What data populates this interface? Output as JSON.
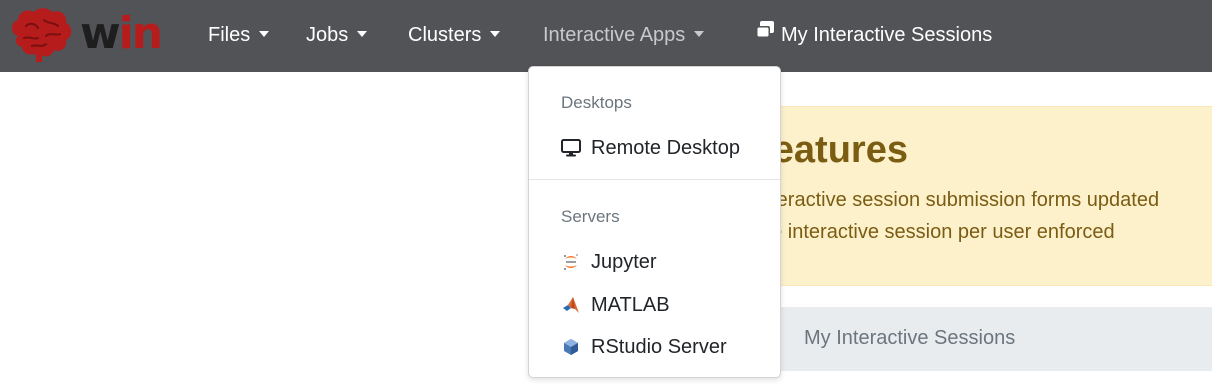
{
  "brand": {
    "logo_text_prefix": "w",
    "logo_text_suffix": "in",
    "logo_icon": "brain-icon",
    "colors": {
      "navbar": "#525356",
      "brain": "#b71c1c"
    }
  },
  "nav": {
    "files": "Files",
    "jobs": "Jobs",
    "clusters": "Clusters",
    "interactive_apps": "Interactive Apps",
    "my_sessions": "My Interactive Sessions",
    "caret_icon": "caret-down-icon",
    "sessions_icon": "window-restore-icon"
  },
  "dropdown": {
    "desktops_header": "Desktops",
    "remote_desktop": "Remote Desktop",
    "servers_header": "Servers",
    "jupyter": "Jupyter",
    "matlab": "MATLAB",
    "rstudio": "RStudio Server",
    "icons": [
      "desktop-icon",
      "jupyter-icon",
      "matlab-icon",
      "rstudio-icon"
    ]
  },
  "alert": {
    "heading_partial": "w features",
    "line1_partial": "nteractive session submission forms updated",
    "line2_partial": "ne interactive session per user enforced",
    "color": "#7a5c12"
  },
  "breadcrumb": {
    "separator": "/",
    "current": "My Interactive Sessions"
  }
}
